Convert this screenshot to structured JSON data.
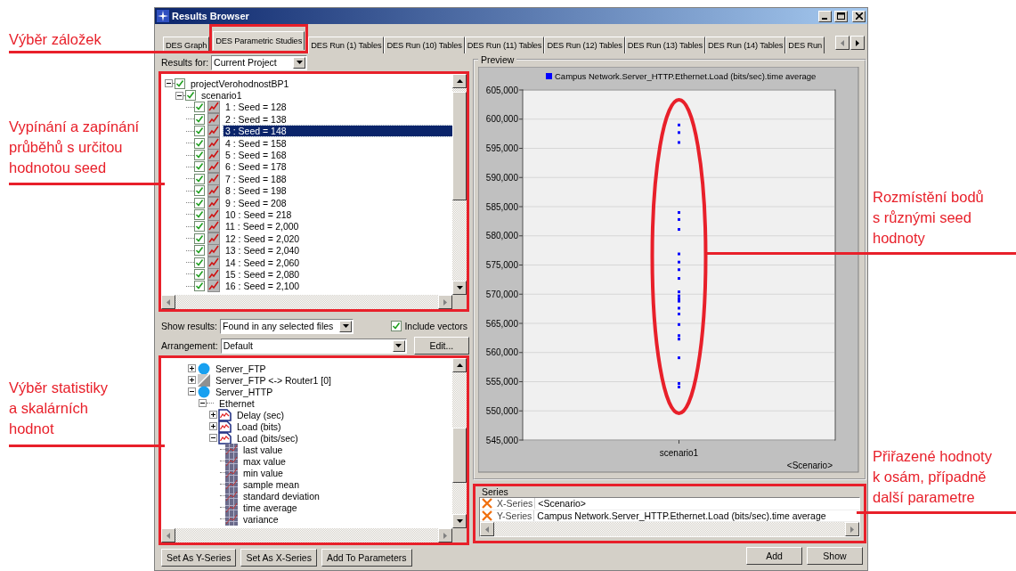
{
  "annotations": {
    "left": [
      {
        "lines": [
          "Výběr záložek"
        ]
      },
      {
        "lines": [
          "Vypínání a zapínání",
          "průběhů s určitou",
          "hodnotou seed"
        ]
      },
      {
        "lines": [
          "Výběr statistiky",
          "a skalárních",
          "hodnot"
        ]
      }
    ],
    "right": [
      {
        "lines": [
          "Rozmístění bodů",
          "s různými seed",
          "hodnoty"
        ]
      },
      {
        "lines": [
          "Přiřazené hodnoty",
          "k osám, případně",
          "další parametre"
        ]
      }
    ]
  },
  "window": {
    "title": "Results Browser"
  },
  "tabs": [
    {
      "label": "DES Graph",
      "selected": false,
      "highlighted": false
    },
    {
      "label": "DES Parametric Studies",
      "selected": true,
      "highlighted": true
    },
    {
      "label": "DES Run (1) Tables",
      "selected": false,
      "highlighted": false
    },
    {
      "label": "DES Run (10) Tables",
      "selected": false,
      "highlighted": false
    },
    {
      "label": "DES Run (11) Tables",
      "selected": false,
      "highlighted": false
    },
    {
      "label": "DES Run (12) Tables",
      "selected": false,
      "highlighted": false
    },
    {
      "label": "DES Run (13) Tables",
      "selected": false,
      "highlighted": false
    },
    {
      "label": "DES Run (14) Tables",
      "selected": false,
      "highlighted": false
    },
    {
      "label": "DES Run",
      "selected": false,
      "highlighted": false
    }
  ],
  "results_for": {
    "label": "Results for:",
    "value": "Current Project"
  },
  "run_tree": {
    "label": "projectVerohodnostBP1",
    "checked": true,
    "expanded": true,
    "children": [
      {
        "label": "scenario1",
        "checked": true,
        "expanded": true,
        "children": [
          {
            "label": "1 : Seed = 128",
            "kind": "run",
            "checked": true,
            "selected": false
          },
          {
            "label": "2 : Seed = 138",
            "kind": "run",
            "checked": true,
            "selected": false
          },
          {
            "label": "3 : Seed = 148",
            "kind": "run",
            "checked": true,
            "selected": true
          },
          {
            "label": "4 : Seed = 158",
            "kind": "run",
            "checked": true,
            "selected": false
          },
          {
            "label": "5 : Seed = 168",
            "kind": "run",
            "checked": true,
            "selected": false
          },
          {
            "label": "6 : Seed = 178",
            "kind": "run",
            "checked": true,
            "selected": false
          },
          {
            "label": "7 : Seed = 188",
            "kind": "run",
            "checked": true,
            "selected": false
          },
          {
            "label": "8 : Seed = 198",
            "kind": "run",
            "checked": true,
            "selected": false
          },
          {
            "label": "9 : Seed = 208",
            "kind": "run",
            "checked": true,
            "selected": false
          },
          {
            "label": "10 : Seed = 218",
            "kind": "run",
            "checked": true,
            "selected": false
          },
          {
            "label": "11 : Seed = 2,000",
            "kind": "run",
            "checked": true,
            "selected": false
          },
          {
            "label": "12 : Seed = 2,020",
            "kind": "run",
            "checked": true,
            "selected": false
          },
          {
            "label": "13 : Seed = 2,040",
            "kind": "run",
            "checked": true,
            "selected": false
          },
          {
            "label": "14 : Seed = 2,060",
            "kind": "run",
            "checked": true,
            "selected": false
          },
          {
            "label": "15 : Seed = 2,080",
            "kind": "run",
            "checked": true,
            "selected": false
          },
          {
            "label": "16 : Seed = 2,100",
            "kind": "run",
            "checked": true,
            "selected": false
          }
        ]
      }
    ]
  },
  "show_results": {
    "label": "Show results:",
    "value": "Found in any selected files"
  },
  "include_vectors": {
    "label": "Include vectors",
    "checked": true
  },
  "arrangement": {
    "label": "Arrangement:",
    "value": "Default",
    "button": "Edit..."
  },
  "stat_tree": [
    {
      "label": "Server_FTP",
      "kind": "node",
      "expanded": false
    },
    {
      "label": "Server_FTP <-> Router1 [0]",
      "kind": "link",
      "expanded": false
    },
    {
      "label": "Server_HTTP",
      "kind": "node",
      "expanded": true,
      "children": [
        {
          "label": "Ethernet",
          "kind": "group",
          "expanded": true,
          "children": [
            {
              "label": "Delay (sec)",
              "kind": "statistic",
              "expanded": false
            },
            {
              "label": "Load (bits)",
              "kind": "statistic",
              "expanded": false
            },
            {
              "label": "Load (bits/sec)",
              "kind": "statistic",
              "expanded": true,
              "children": [
                {
                  "label": "last value",
                  "kind": "scalar"
                },
                {
                  "label": "max value",
                  "kind": "scalar"
                },
                {
                  "label": "min value",
                  "kind": "scalar"
                },
                {
                  "label": "sample mean",
                  "kind": "scalar"
                },
                {
                  "label": "standard deviation",
                  "kind": "scalar"
                },
                {
                  "label": "time average",
                  "kind": "scalar"
                },
                {
                  "label": "variance",
                  "kind": "scalar"
                }
              ]
            }
          ]
        }
      ]
    }
  ],
  "left_buttons": [
    "Set As Y-Series",
    "Set As X-Series",
    "Add To Parameters"
  ],
  "preview": {
    "title": "Preview",
    "chart_data": {
      "type": "scatter",
      "xlabel": "<Scenario>",
      "categories": [
        "scenario1"
      ],
      "grid": true,
      "series": [
        {
          "name": "Campus Network.Server_HTTP.Ethernet.Load (bits/sec).time average",
          "color": "#0000ff",
          "values": [
            599000
          ]
        },
        {
          "color": "#0000ff",
          "values": [
            597700
          ]
        },
        {
          "color": "#0000ff",
          "values": [
            596000
          ]
        },
        {
          "color": "#0000ff",
          "values": [
            584000
          ]
        },
        {
          "color": "#0000ff",
          "values": [
            582800
          ]
        },
        {
          "color": "#0000ff",
          "values": [
            581100
          ]
        },
        {
          "color": "#0000ff",
          "values": [
            576900
          ]
        },
        {
          "color": "#0000ff",
          "values": [
            575500
          ]
        },
        {
          "color": "#0000ff",
          "values": [
            574200
          ]
        },
        {
          "color": "#0000ff",
          "values": [
            572700
          ]
        },
        {
          "color": "#0000ff",
          "values": [
            570400
          ]
        },
        {
          "color": "#0000ff",
          "values": [
            569700
          ]
        },
        {
          "color": "#0000ff",
          "values": [
            569200
          ]
        },
        {
          "color": "#0000ff",
          "values": [
            568800
          ]
        },
        {
          "color": "#0000ff",
          "values": [
            567600
          ]
        },
        {
          "color": "#0000ff",
          "values": [
            566600
          ]
        },
        {
          "color": "#0000ff",
          "values": [
            564800
          ]
        },
        {
          "color": "#0000ff",
          "values": [
            562900
          ]
        },
        {
          "color": "#0000ff",
          "values": [
            562300
          ]
        },
        {
          "color": "#0000ff",
          "values": [
            559100
          ]
        },
        {
          "color": "#0000ff",
          "values": [
            554700
          ]
        },
        {
          "color": "#0000ff",
          "values": [
            554100
          ]
        }
      ],
      "ylim": [
        545000,
        605000
      ],
      "yticks": [
        {
          "value": 545000,
          "label": "545,000"
        },
        {
          "value": 550000,
          "label": "550,000"
        },
        {
          "value": 555000,
          "label": "555,000"
        },
        {
          "value": 560000,
          "label": "560,000"
        },
        {
          "value": 565000,
          "label": "565,000"
        },
        {
          "value": 570000,
          "label": "570,000"
        },
        {
          "value": 575000,
          "label": "575,000"
        },
        {
          "value": 580000,
          "label": "580,000"
        },
        {
          "value": 585000,
          "label": "585,000"
        },
        {
          "value": 590000,
          "label": "590,000"
        },
        {
          "value": 595000,
          "label": "595,000"
        },
        {
          "value": 600000,
          "label": "600,000"
        },
        {
          "value": 605000,
          "label": "605,000"
        }
      ]
    }
  },
  "series": {
    "title": "Series",
    "rows": [
      {
        "axis": "X-Series",
        "value": "<Scenario>"
      },
      {
        "axis": "Y-Series",
        "value": "Campus Network.Server_HTTP.Ethernet.Load (bits/sec).time average"
      }
    ]
  },
  "right_buttons": [
    "Add",
    "Show"
  ]
}
